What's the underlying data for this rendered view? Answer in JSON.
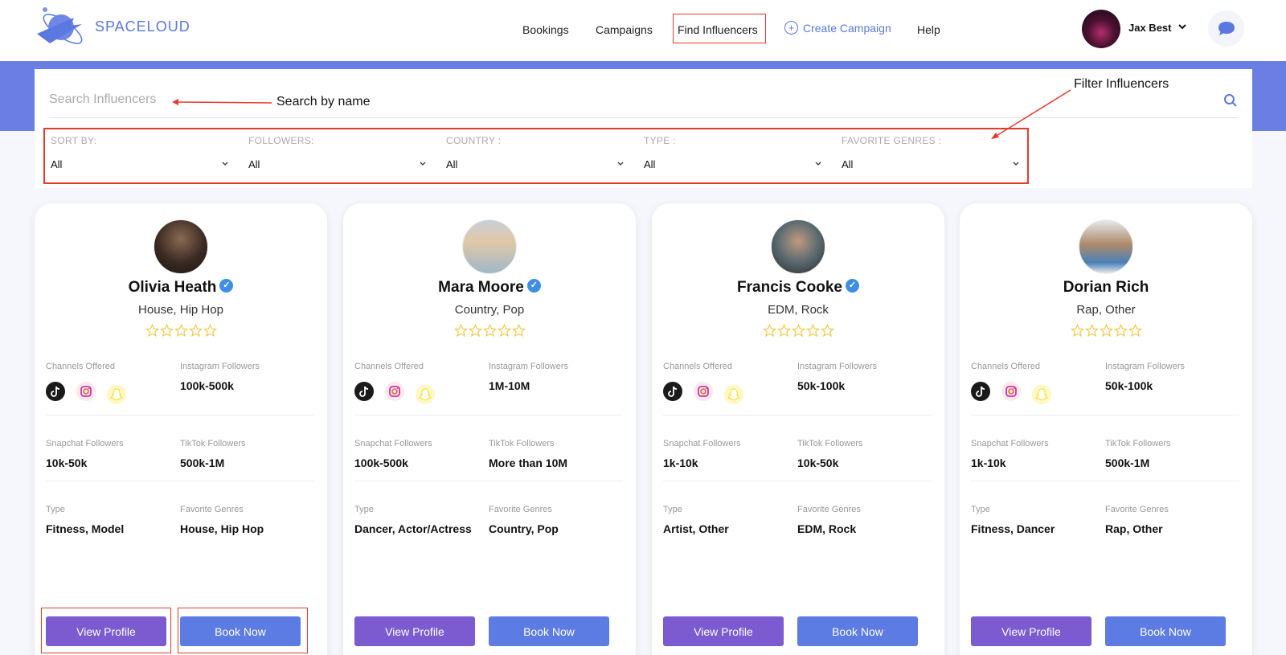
{
  "header": {
    "brand": "SPACELOUD",
    "nav": [
      "Bookings",
      "Campaigns",
      "Find Influencers",
      "Create Campaign",
      "Help"
    ],
    "user_name": "Jax Best"
  },
  "search": {
    "placeholder": "Search Influencers"
  },
  "annotations": {
    "search_note": "Search by name",
    "filter_note": "Filter Influencers"
  },
  "filters": [
    {
      "label": "SORT BY:",
      "value": "All"
    },
    {
      "label": "FOLLOWERS:",
      "value": "All"
    },
    {
      "label": "COUNTRY :",
      "value": "All"
    },
    {
      "label": "TYPE :",
      "value": "All"
    },
    {
      "label": "FAVORITE GENRES :",
      "value": "All"
    }
  ],
  "labels": {
    "channels": "Channels Offered",
    "instagram": "Instagram Followers",
    "snapchat": "Snapchat Followers",
    "tiktok": "TikTok Followers",
    "type": "Type",
    "genres": "Favorite Genres",
    "view_profile": "View Profile",
    "book_now": "Book Now"
  },
  "influencers": [
    {
      "name": "Olivia Heath",
      "verified": true,
      "genres": "House, Hip Hop",
      "rating": 0,
      "instagram": "100k-500k",
      "snapchat": "10k-50k",
      "tiktok": "500k-1M",
      "type": "Fitness, Model",
      "favorite_genres": "House, Hip Hop"
    },
    {
      "name": "Mara Moore",
      "verified": true,
      "genres": "Country, Pop",
      "rating": 0,
      "instagram": "1M-10M",
      "snapchat": "100k-500k",
      "tiktok": "More than 10M",
      "type": "Dancer, Actor/Actress",
      "favorite_genres": "Country, Pop"
    },
    {
      "name": "Francis Cooke",
      "verified": true,
      "genres": "EDM, Rock",
      "rating": 0,
      "instagram": "50k-100k",
      "snapchat": "1k-10k",
      "tiktok": "10k-50k",
      "type": "Artist, Other",
      "favorite_genres": "EDM, Rock"
    },
    {
      "name": "Dorian Rich",
      "verified": false,
      "genres": "Rap, Other",
      "rating": 0,
      "instagram": "50k-100k",
      "snapchat": "1k-10k",
      "tiktok": "500k-1M",
      "type": "Fitness, Dancer",
      "favorite_genres": "Rap, Other"
    }
  ],
  "colors": {
    "accent": "#5a78e0",
    "band": "#6a7ee3",
    "view_button": "#7c5bd0",
    "book_button": "#5c7ce3",
    "highlight": "#e53a2a",
    "star": "#f2c94c"
  }
}
